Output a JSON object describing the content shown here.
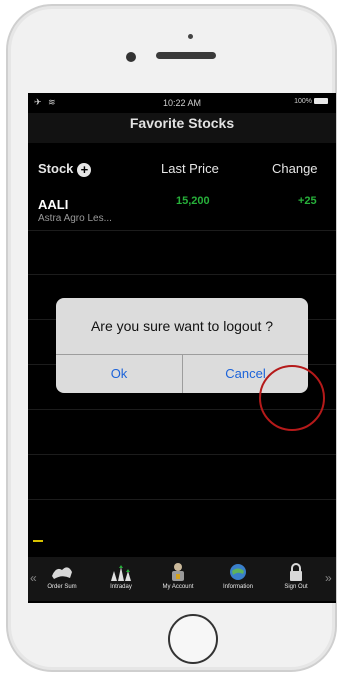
{
  "status_bar": {
    "time": "10:22 AM",
    "battery": "100%"
  },
  "header": {
    "title": "Favorite Stocks"
  },
  "table": {
    "columns": [
      "Stock",
      "Last Price",
      "Change"
    ],
    "rows": [
      {
        "symbol": "AALI",
        "name": "Astra Agro Les...",
        "last_price": "15,200",
        "change": "+25"
      }
    ]
  },
  "dialog": {
    "message": "Are you sure want to logout ?",
    "ok_label": "Ok",
    "cancel_label": "Cancel"
  },
  "tabbar": {
    "items": [
      {
        "label": "Order Sum",
        "icon": "order-sum-icon"
      },
      {
        "label": "Intraday",
        "icon": "intraday-icon"
      },
      {
        "label": "My Account",
        "icon": "my-account-icon"
      },
      {
        "label": "Information",
        "icon": "information-icon"
      },
      {
        "label": "Sign Out",
        "icon": "sign-out-icon"
      }
    ]
  },
  "colors": {
    "gain": "#27b03a",
    "link": "#1c63d9",
    "tap_highlight": "#b51a1a"
  }
}
